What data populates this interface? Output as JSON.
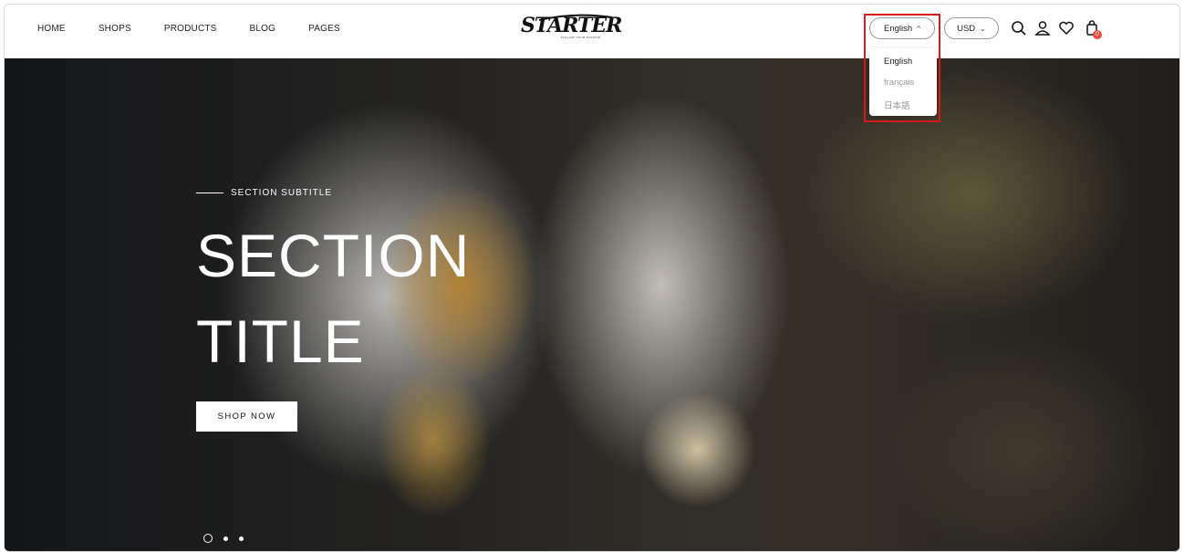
{
  "nav": {
    "items": [
      "HOME",
      "SHOPS",
      "PRODUCTS",
      "BLOG",
      "PAGES"
    ]
  },
  "brand": {
    "logo_text": "STARTER",
    "tagline": "FOLLOW YOUR PASSION"
  },
  "language": {
    "selected": "English",
    "options": [
      "English",
      "français",
      "日本語"
    ]
  },
  "currency": {
    "selected": "USD"
  },
  "cart": {
    "count": "0"
  },
  "hero": {
    "subtitle": "SECTION SUBTITLE",
    "title_line1": "SECTION",
    "title_line2": "TITLE",
    "button_label": "SHOP NOW",
    "slide_count": 3,
    "active_slide": 1
  },
  "colors": {
    "accent_badge": "#e94b3c",
    "highlight": "#d41a1a"
  },
  "icons": [
    "search-icon",
    "account-icon",
    "wishlist-heart-icon",
    "cart-bag-icon"
  ]
}
